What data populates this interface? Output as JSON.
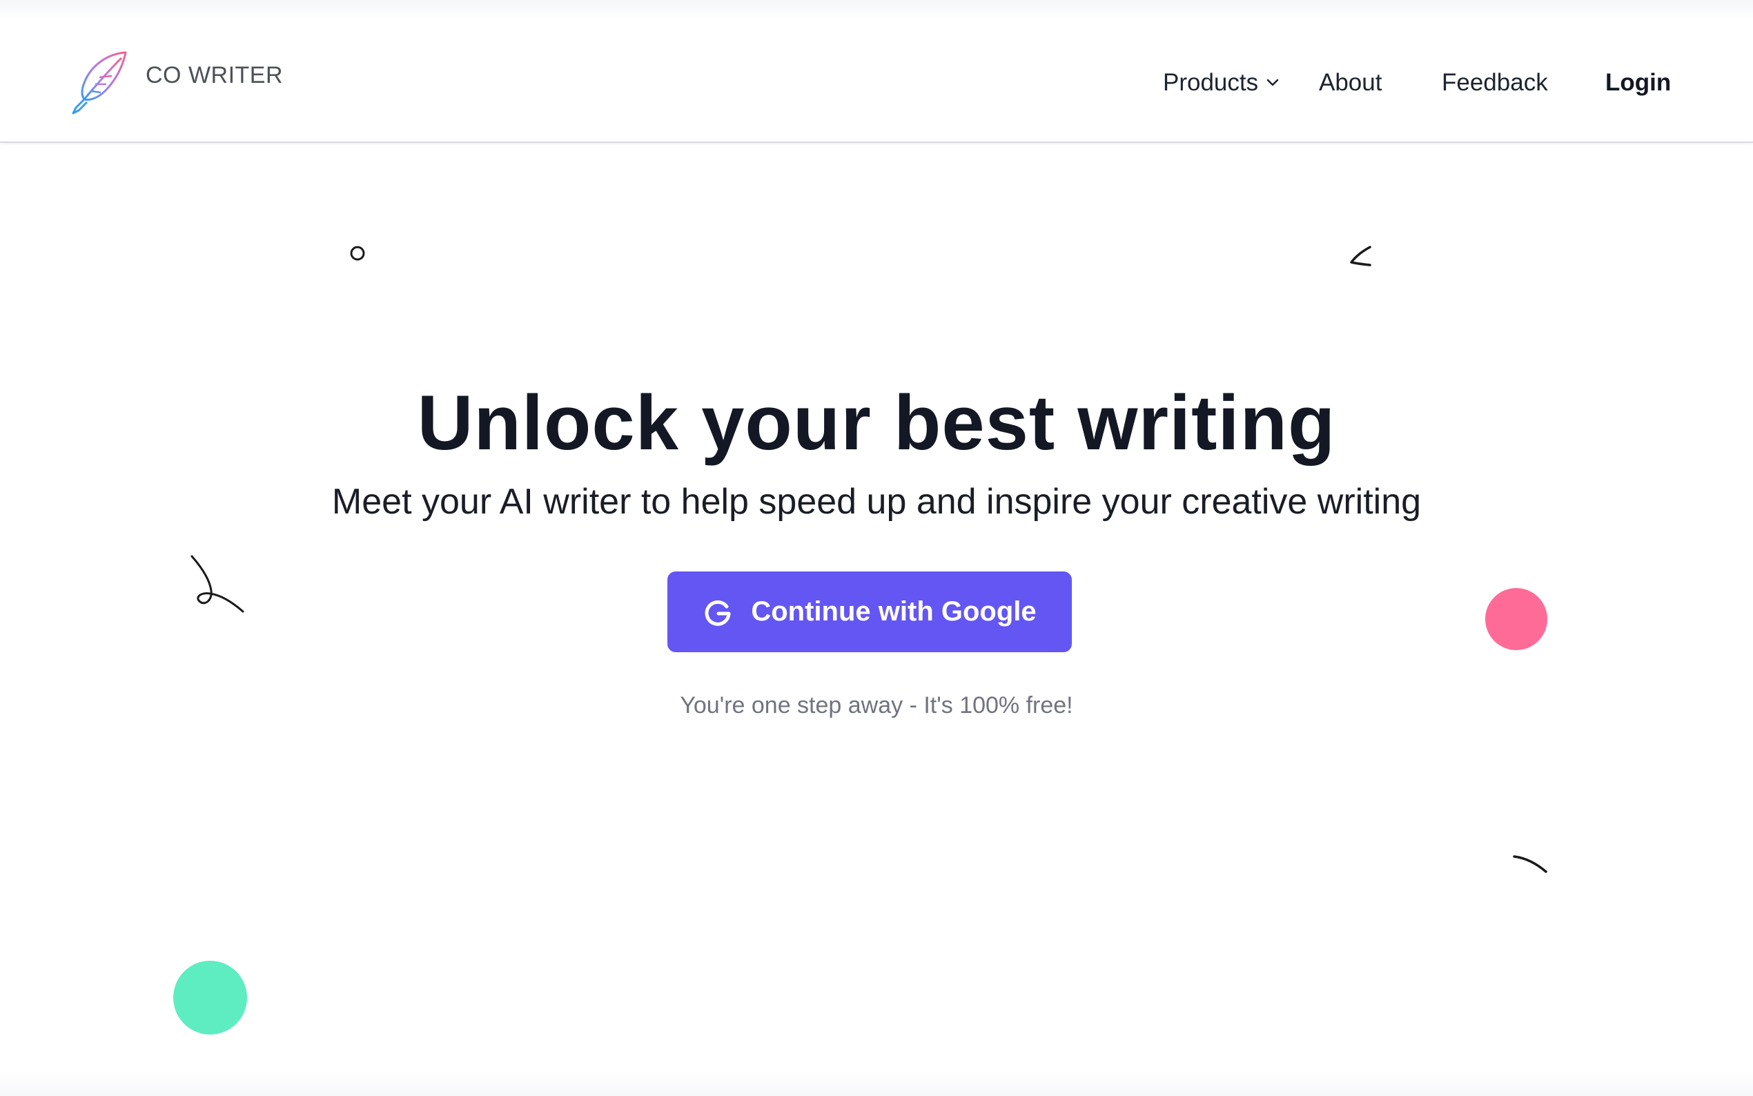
{
  "brand": {
    "name": "CO WRITER",
    "logo_icon": "feather-quill-icon"
  },
  "nav": {
    "products_label": "Products",
    "products_icon": "chevron-down-icon",
    "about_label": "About",
    "feedback_label": "Feedback",
    "login_label": "Login"
  },
  "hero": {
    "title": "Unlock your best writing",
    "subtitle": "Meet your AI writer to help speed up and inspire your creative writing",
    "cta_label": "Continue with Google",
    "cta_icon": "google-icon",
    "note": "You're one step away - It's 100% free!"
  },
  "colors": {
    "primary_button": "#6356f2",
    "heading_text": "#141824",
    "note_text": "#707380",
    "decor_pink": "#ff6b97",
    "decor_green": "#5eedc0"
  }
}
